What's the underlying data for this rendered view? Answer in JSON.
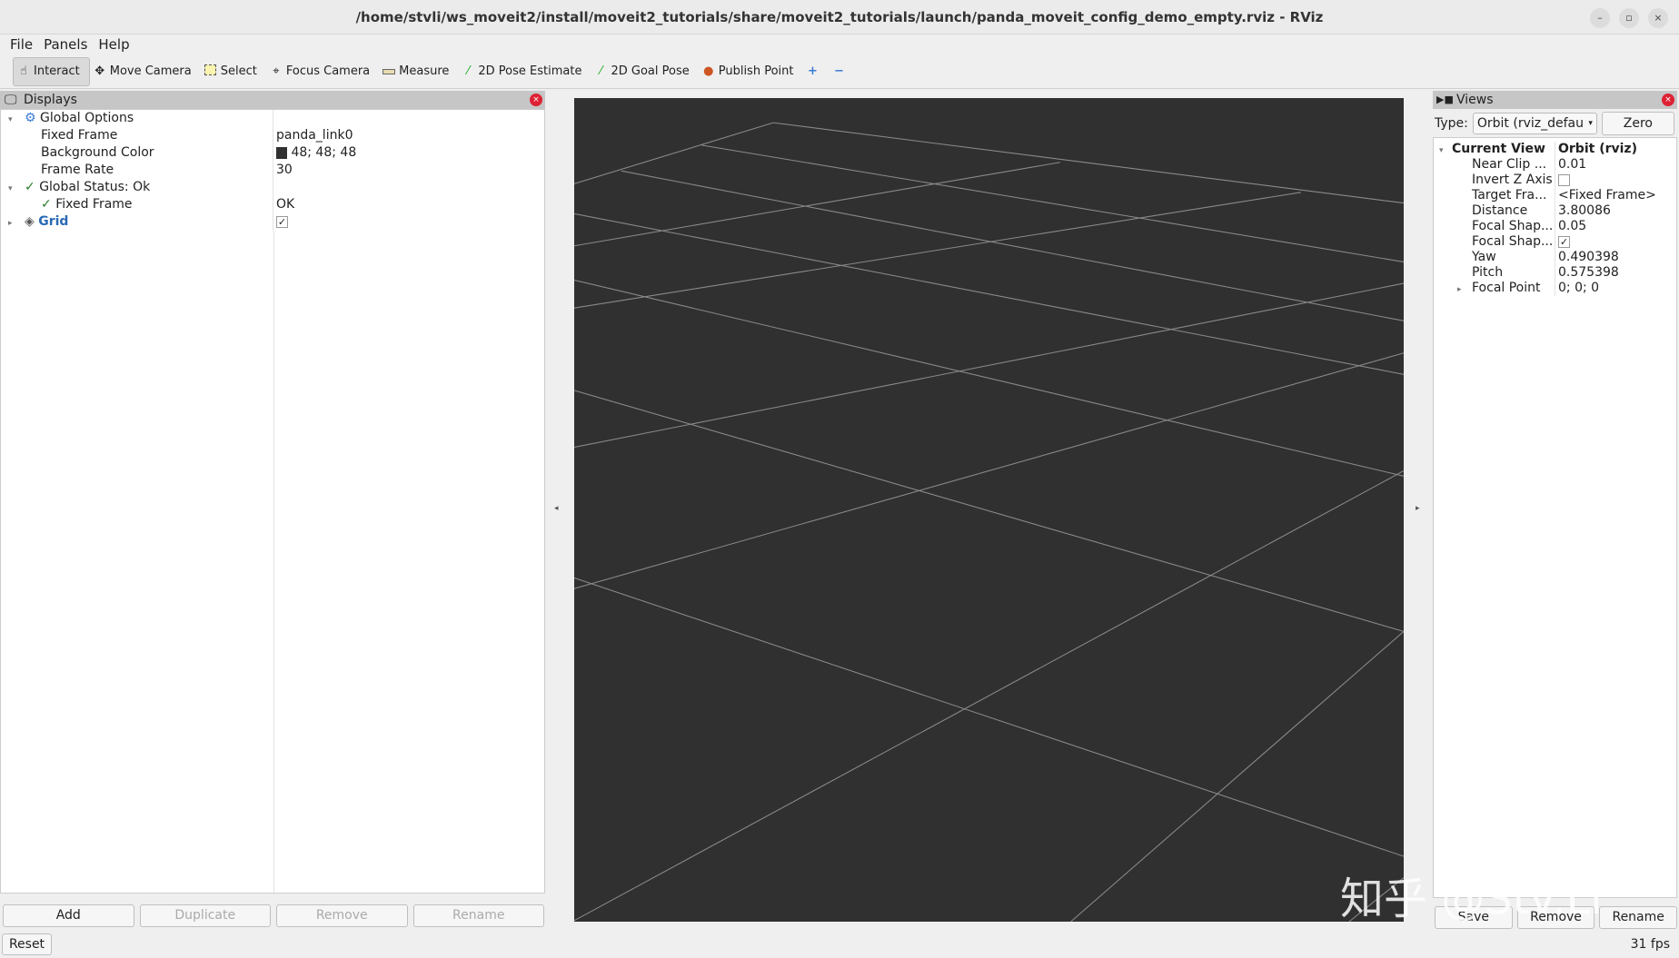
{
  "window": {
    "title": "/home/stvli/ws_moveit2/install/moveit2_tutorials/share/moveit2_tutorials/launch/panda_moveit_config_demo_empty.rviz - RViz"
  },
  "menu": [
    "File",
    "Panels",
    "Help"
  ],
  "toolbar": [
    {
      "label": "Interact",
      "icon": "hand-icon",
      "active": true
    },
    {
      "label": "Move Camera",
      "icon": "move-camera-icon"
    },
    {
      "label": "Select",
      "icon": "select-icon"
    },
    {
      "label": "Focus Camera",
      "icon": "focus-camera-icon"
    },
    {
      "label": "Measure",
      "icon": "ruler-icon"
    },
    {
      "label": "2D Pose Estimate",
      "icon": "green-arrow-icon"
    },
    {
      "label": "2D Goal Pose",
      "icon": "green-arrow-icon"
    },
    {
      "label": "Publish Point",
      "icon": "map-pin-icon"
    }
  ],
  "displays": {
    "title": "Displays",
    "rows": [
      {
        "name": "Global Options",
        "value": ""
      },
      {
        "name": "Fixed Frame",
        "value": "panda_link0"
      },
      {
        "name": "Background Color",
        "value": "48; 48; 48"
      },
      {
        "name": "Frame Rate",
        "value": "30"
      },
      {
        "name": "Global Status: Ok",
        "value": ""
      },
      {
        "name": "Fixed Frame",
        "value": "OK"
      },
      {
        "name": "Grid",
        "value": "✓"
      }
    ],
    "buttons": [
      "Add",
      "Duplicate",
      "Remove",
      "Rename"
    ],
    "bg_swatch": "#303030"
  },
  "views": {
    "title": "Views",
    "type_label": "Type:",
    "type_value": "Orbit (rviz_defau",
    "zero": "Zero",
    "rows": [
      {
        "name": "Current View",
        "value": "Orbit (rviz)"
      },
      {
        "name": "Near Clip ...",
        "value": "0.01"
      },
      {
        "name": "Invert Z Axis",
        "value": ""
      },
      {
        "name": "Target Fra...",
        "value": "<Fixed Frame>"
      },
      {
        "name": "Distance",
        "value": "3.80086"
      },
      {
        "name": "Focal Shap...",
        "value": "0.05"
      },
      {
        "name": "Focal Shap...",
        "value": "✓"
      },
      {
        "name": "Yaw",
        "value": "0.490398"
      },
      {
        "name": "Pitch",
        "value": "0.575398"
      },
      {
        "name": "Focal Point",
        "value": "0; 0; 0"
      }
    ],
    "buttons": [
      "Save",
      "Remove",
      "Rename"
    ]
  },
  "status": {
    "reset": "Reset",
    "fps": "31 fps"
  },
  "watermark": "知乎 @Stv.Li"
}
